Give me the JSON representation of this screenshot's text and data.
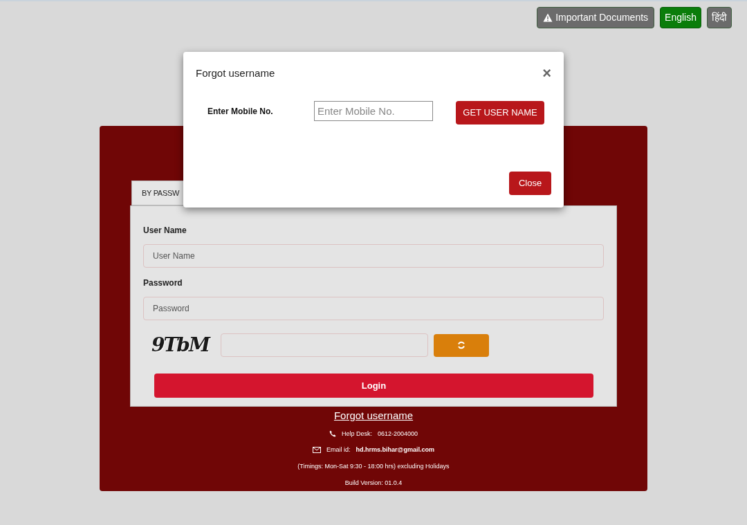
{
  "top_bar": {
    "documents_button": "Important Documents",
    "languages": [
      {
        "label": "English",
        "selected": true
      },
      {
        "label": "हिंदी",
        "selected": false
      }
    ]
  },
  "login": {
    "tabs": [
      {
        "label": "BY PASSW",
        "selected": true
      }
    ],
    "fields": [
      {
        "label": "User Name",
        "placeholder": "User Name"
      },
      {
        "label": "Password",
        "placeholder": "Password"
      }
    ],
    "captcha": "9TbM",
    "login_button": "Login"
  },
  "footer": {
    "forgot_link": "Forgot username",
    "help_desk_label": "Help Desk:",
    "help_desk_number": "0612-2004000",
    "email_label": "Email id:",
    "email": "hd.hrms.bihar@gmail.com",
    "timings": "(Timings: Mon-Sat 9:30 - 18:00 hrs) excluding Holidays",
    "build": "Build Version: 01.0.4"
  },
  "modal": {
    "title": "Forgot username",
    "close_x": "×",
    "label": "Enter Mobile No.",
    "placeholder": "Enter Mobile No.",
    "submit": "GET USER NAME",
    "close": "Close"
  }
}
